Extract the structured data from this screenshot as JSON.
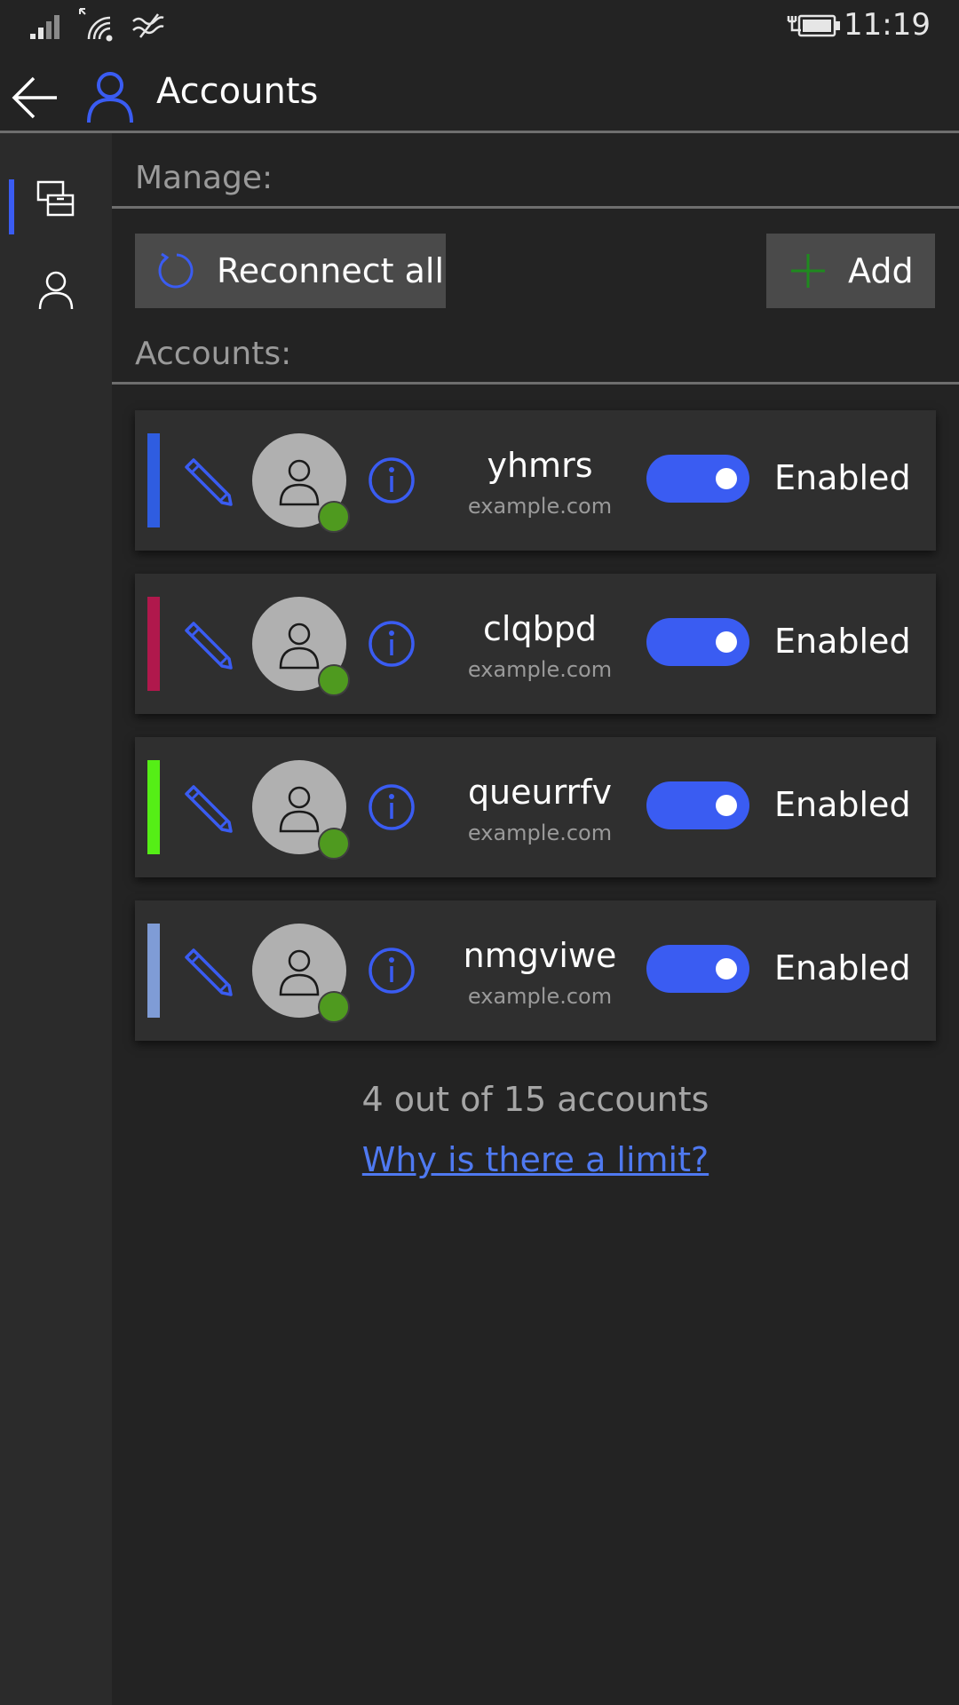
{
  "status_bar": {
    "time": "11:19",
    "icons": [
      "signal-icon",
      "wifi-icon",
      "data-saver-icon",
      "battery-charging-icon"
    ]
  },
  "header": {
    "title": "Accounts",
    "back_icon": "back-arrow-icon",
    "title_icon": "person-icon"
  },
  "rail": {
    "items": [
      {
        "icon": "devices-icon",
        "selected": true
      },
      {
        "icon": "person-icon",
        "selected": false
      }
    ]
  },
  "manage": {
    "label": "Manage:",
    "reconnect_label": "Reconnect all",
    "add_label": "Add"
  },
  "accounts_section": {
    "label": "Accounts:",
    "items": [
      {
        "name": "yhmrs",
        "domain": "example.com",
        "status": "Enabled",
        "enabled": true,
        "color": "#2f5de0"
      },
      {
        "name": "clqbpd",
        "domain": "example.com",
        "status": "Enabled",
        "enabled": true,
        "color": "#b0184c"
      },
      {
        "name": "queurrfv",
        "domain": "example.com",
        "status": "Enabled",
        "enabled": true,
        "color": "#55ee16"
      },
      {
        "name": "nmgviwe",
        "domain": "example.com",
        "status": "Enabled",
        "enabled": true,
        "color": "#7f9cd6"
      }
    ],
    "summary": "4 out of 15 accounts",
    "limit_link": "Why is there a limit?"
  },
  "colors": {
    "accent": "#3a5cf2",
    "presence_online": "#4f9a1f",
    "add_icon": "#1f8a1f"
  }
}
